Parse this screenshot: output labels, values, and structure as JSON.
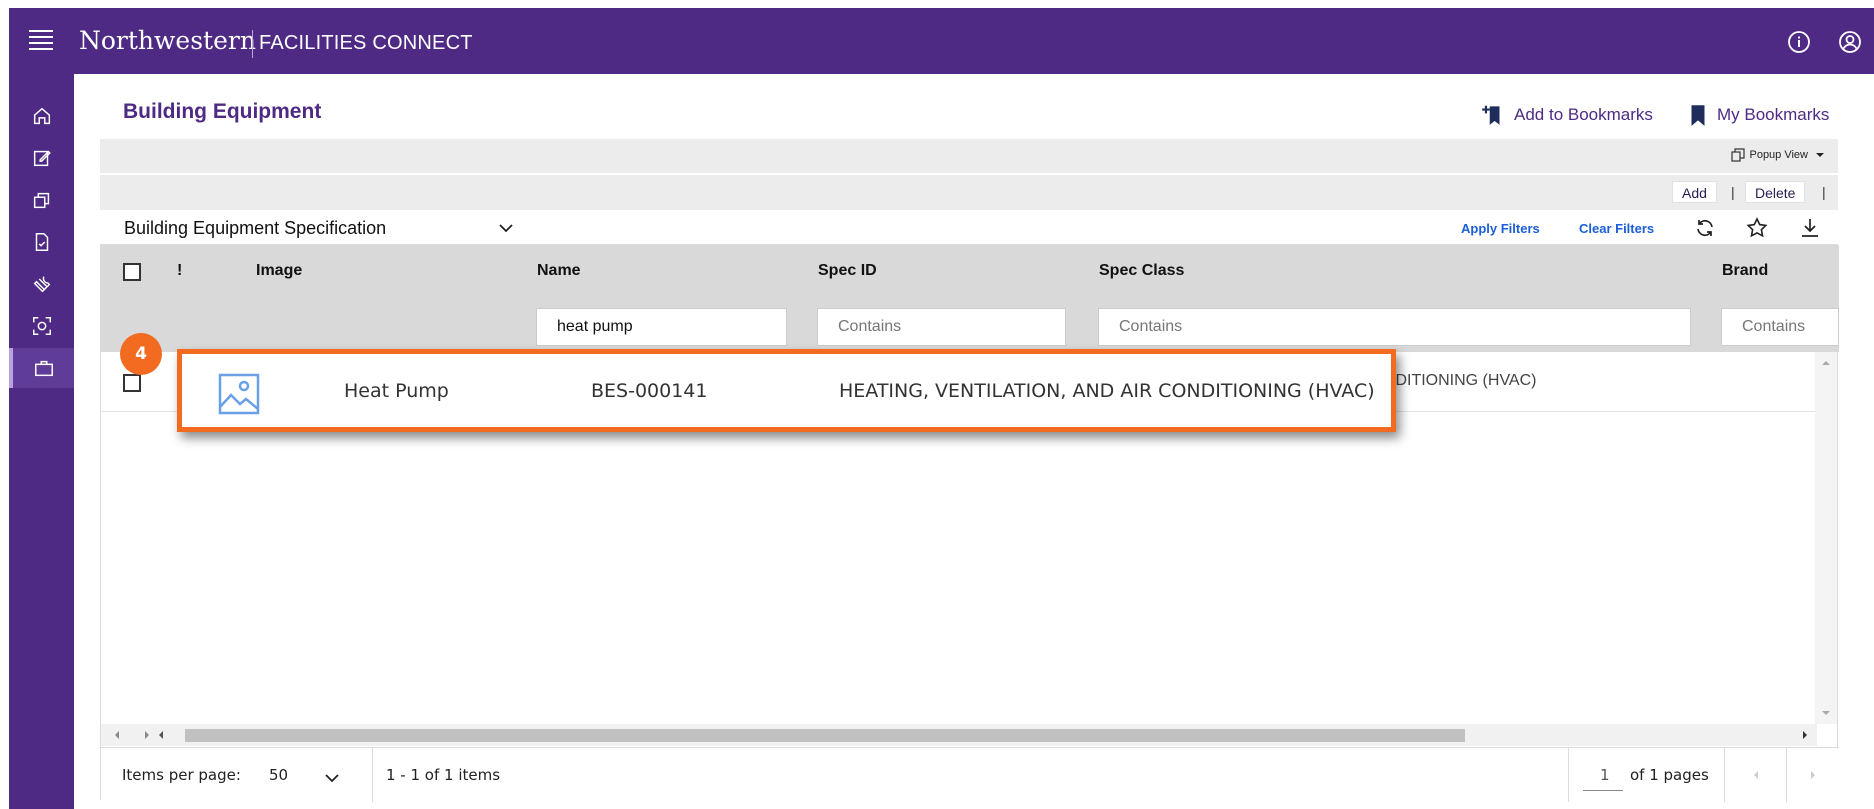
{
  "header": {
    "brand": "Northwestern",
    "product": "FACILITIES CONNECT",
    "icons": [
      "menu-icon",
      "info-icon",
      "user-icon"
    ]
  },
  "sidebar": {
    "items": [
      {
        "name": "home-icon"
      },
      {
        "name": "edit-icon"
      },
      {
        "name": "copy-icon"
      },
      {
        "name": "document-icon"
      },
      {
        "name": "wrench-icon"
      },
      {
        "name": "scan-icon"
      },
      {
        "name": "briefcase-icon",
        "active": true
      }
    ]
  },
  "page": {
    "title": "Building Equipment",
    "add_bookmark": "Add to Bookmarks",
    "my_bookmarks": "My Bookmarks"
  },
  "toolbar": {
    "popup_view": "Popup View",
    "add": "Add",
    "delete": "Delete",
    "separator": "|"
  },
  "filterbar": {
    "spec_select": "Building Equipment Specification",
    "apply_filters": "Apply Filters",
    "clear_filters": "Clear Filters"
  },
  "grid": {
    "columns": {
      "flag": "!",
      "image": "Image",
      "name": "Name",
      "spec_id": "Spec ID",
      "spec_class": "Spec Class",
      "brand": "Brand"
    },
    "filters": {
      "name": "heat pump",
      "spec_id_placeholder": "Contains",
      "spec_class_placeholder": "Contains",
      "brand_placeholder": "Contains"
    },
    "row_partial_spec_class": "IDITIONING (HVAC)"
  },
  "highlight": {
    "step": "4",
    "name": "Heat Pump",
    "spec_id": "BES-000141",
    "spec_class": "HEATING, VENTILATION, AND AIR CONDITIONING (HVAC)"
  },
  "pager": {
    "items_per_page_label": "Items per page:",
    "items_per_page": "50",
    "range": "1 - 1 of 1 items",
    "page": "1",
    "of_pages": "of 1 pages"
  },
  "colors": {
    "brand_purple": "#4e2a84",
    "highlight_orange": "#f26b21",
    "link_blue": "#1a5ed9"
  }
}
